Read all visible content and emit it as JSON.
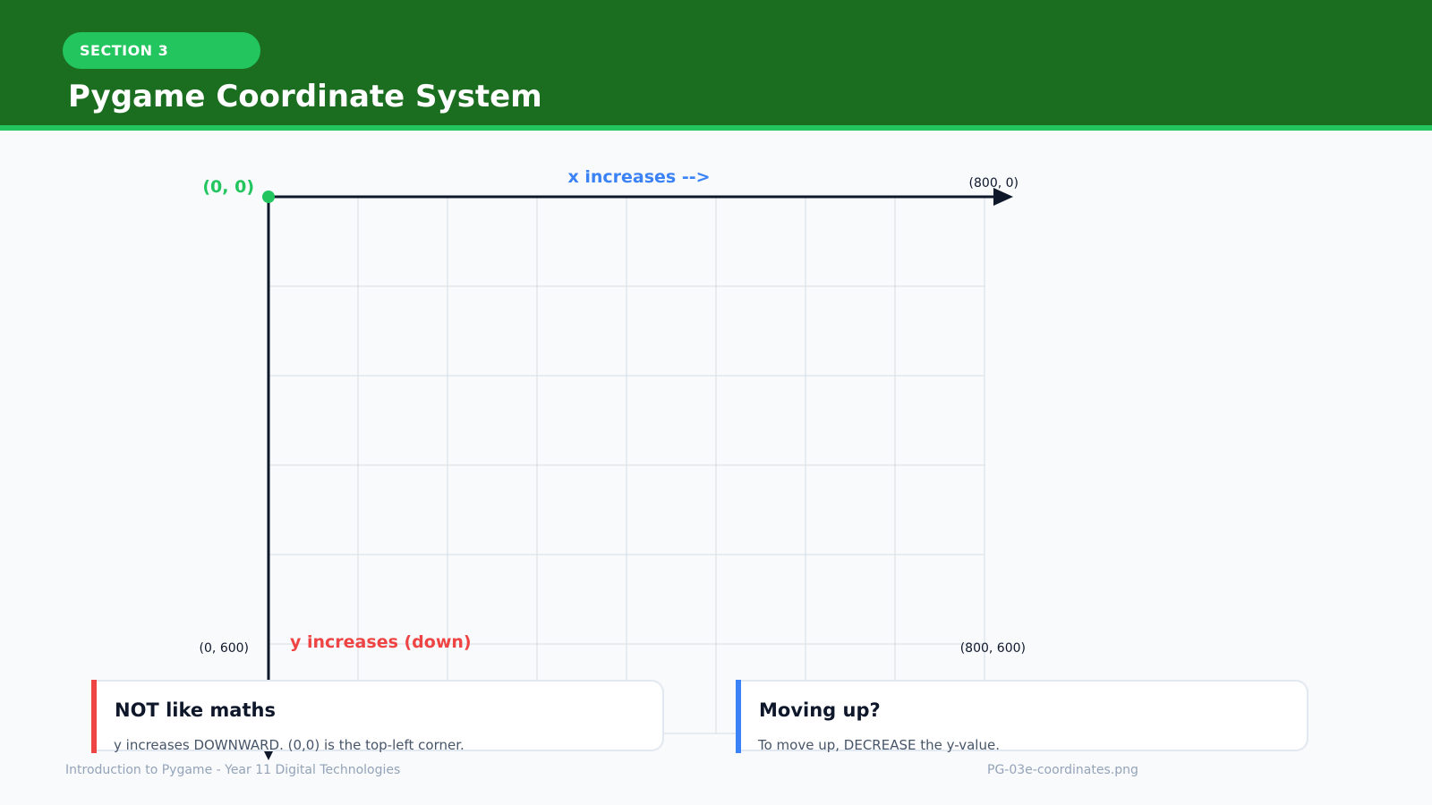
{
  "header": {
    "section_label": "SECTION 3",
    "title": "Pygame Coordinate System"
  },
  "diagram": {
    "origin_label": "(0, 0)",
    "x_axis_label": "x increases -->",
    "y_axis_label": "y increases (down)",
    "corner_top_right": "(800, 0)",
    "corner_bottom_left": "(0, 600)",
    "corner_bottom_right": "(800, 600)",
    "screen_width": 800,
    "screen_height": 600,
    "grid_step": 100,
    "colors": {
      "origin": "#22c55e",
      "x_label": "#3b82f6",
      "y_label": "#ef4444",
      "axis": "#0f172a",
      "grid": "#d6dde6"
    }
  },
  "cards": [
    {
      "title": "NOT like maths",
      "text": "y increases DOWNWARD. (0,0) is the top-left corner.",
      "accent": "#ef4444"
    },
    {
      "title": "Moving up?",
      "text": "To move up, DECREASE the y-value.",
      "accent": "#3b82f6"
    }
  ],
  "footer": {
    "left": "Introduction to Pygame - Year 11 Digital Technologies",
    "right": "PG-03e-coordinates.png"
  }
}
